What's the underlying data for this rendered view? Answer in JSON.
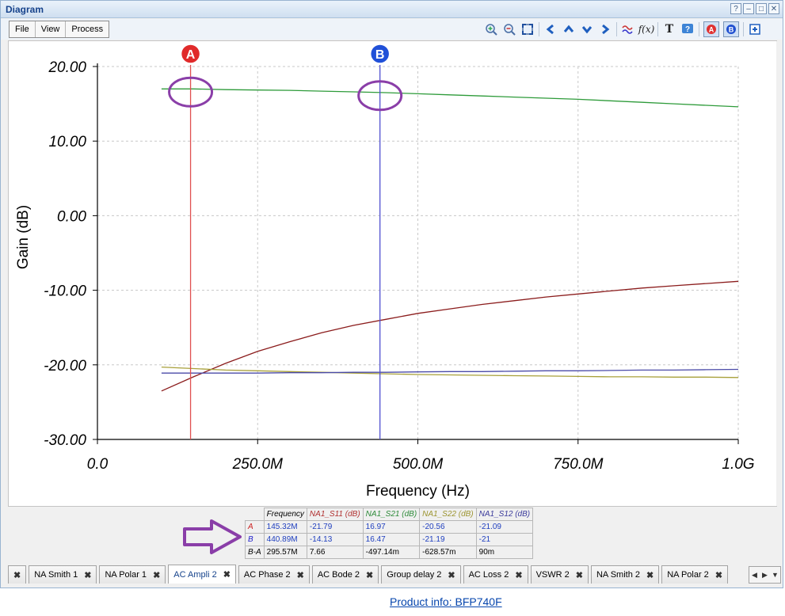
{
  "window": {
    "title": "Diagram",
    "buttons": [
      "?",
      "–",
      "□",
      "✕"
    ]
  },
  "menu": [
    "File",
    "View",
    "Process"
  ],
  "toolbar_icons": [
    "zoom-in-icon",
    "zoom-out-icon",
    "zoom-fit-icon",
    "arrow-left-icon",
    "arrow-up-icon",
    "arrow-down-icon",
    "arrow-right-icon",
    "wave-icon",
    "function-icon",
    "text-icon",
    "help-icon",
    "cursor-a-icon",
    "cursor-b-icon",
    "add-icon"
  ],
  "chart_data": {
    "type": "line",
    "xlabel": "Frequency (Hz)",
    "ylabel": "Gain (dB)",
    "xlim": [
      0,
      1000000000
    ],
    "ylim": [
      -30,
      20
    ],
    "x_ticks": [
      "0.0",
      "250.0M",
      "500.0M",
      "750.0M",
      "1.0G"
    ],
    "y_ticks": [
      "20.00",
      "10.00",
      "0.00",
      "-10.00",
      "-20.00",
      "-30.00"
    ],
    "grid": true,
    "x_mhz": [
      100,
      150,
      200,
      250,
      300,
      350,
      400,
      450,
      500,
      550,
      600,
      650,
      700,
      750,
      800,
      850,
      900,
      950,
      1000
    ],
    "series": [
      {
        "name": "NA1_S21 (dB)",
        "color": "#2e9b3a",
        "values": [
          17.0,
          17.0,
          16.9,
          16.85,
          16.8,
          16.7,
          16.6,
          16.5,
          16.35,
          16.2,
          16.05,
          15.9,
          15.75,
          15.6,
          15.4,
          15.2,
          15.0,
          14.8,
          14.6
        ]
      },
      {
        "name": "NA1_S11 (dB)",
        "color": "#8b1c1c",
        "values": [
          -23.5,
          -21.6,
          -19.8,
          -18.2,
          -16.9,
          -15.7,
          -14.7,
          -13.9,
          -13.1,
          -12.5,
          -11.9,
          -11.4,
          -10.9,
          -10.5,
          -10.1,
          -9.7,
          -9.4,
          -9.1,
          -8.8
        ]
      },
      {
        "name": "NA1_S22 (dB)",
        "color": "#a8a03a",
        "values": [
          -20.3,
          -20.5,
          -20.7,
          -20.8,
          -20.9,
          -21.0,
          -21.1,
          -21.2,
          -21.3,
          -21.35,
          -21.4,
          -21.45,
          -21.5,
          -21.55,
          -21.6,
          -21.6,
          -21.65,
          -21.65,
          -21.7
        ]
      },
      {
        "name": "NA1_S12 (dB)",
        "color": "#4b4ba8",
        "values": [
          -21.1,
          -21.1,
          -21.1,
          -21.1,
          -21.05,
          -21.05,
          -21.0,
          -21.0,
          -20.95,
          -20.9,
          -20.9,
          -20.85,
          -20.8,
          -20.8,
          -20.75,
          -20.7,
          -20.7,
          -20.65,
          -20.6
        ]
      }
    ],
    "cursors": [
      {
        "label": "A",
        "x": 145320000,
        "color": "#e05050"
      },
      {
        "label": "B",
        "x": 440890000,
        "color": "#5050d0"
      }
    ],
    "highlight_color": "#8a3ea8"
  },
  "marker_table": {
    "headers": [
      "Frequency",
      "NA1_S11 (dB)",
      "NA1_S21 (dB)",
      "NA1_S22 (dB)",
      "NA1_S12 (dB)"
    ],
    "header_colors": [
      "#000000",
      "#b03030",
      "#2e8b3a",
      "#9c9430",
      "#3b3b9c"
    ],
    "rows": [
      {
        "label": "A",
        "label_color": "#cc2222",
        "cells": [
          "145.32M",
          "-21.79",
          "16.97",
          "-20.56",
          "-21.09"
        ],
        "value_color": "#1f3fbf"
      },
      {
        "label": "B",
        "label_color": "#2222cc",
        "cells": [
          "440.89M",
          "-14.13",
          "16.47",
          "-21.19",
          "-21"
        ],
        "value_color": "#1f3fbf"
      },
      {
        "label": "B-A",
        "label_color": "#000000",
        "cells": [
          "295.57M",
          "7.66",
          "-497.14m",
          "-628.57m",
          "90m"
        ],
        "value_color": "#000000"
      }
    ]
  },
  "tabs": [
    {
      "label": "NA Smith 1",
      "active": false
    },
    {
      "label": "NA Polar 1",
      "active": false
    },
    {
      "label": "AC Ampli 2",
      "active": true
    },
    {
      "label": "AC Phase 2",
      "active": false
    },
    {
      "label": "AC Bode 2",
      "active": false
    },
    {
      "label": "Group delay 2",
      "active": false
    },
    {
      "label": "AC Loss 2",
      "active": false
    },
    {
      "label": "VSWR 2",
      "active": false
    },
    {
      "label": "NA Smith 2",
      "active": false
    },
    {
      "label": "NA Polar 2",
      "active": false
    }
  ],
  "footer": {
    "link_text": "Product info: BFP740F"
  }
}
